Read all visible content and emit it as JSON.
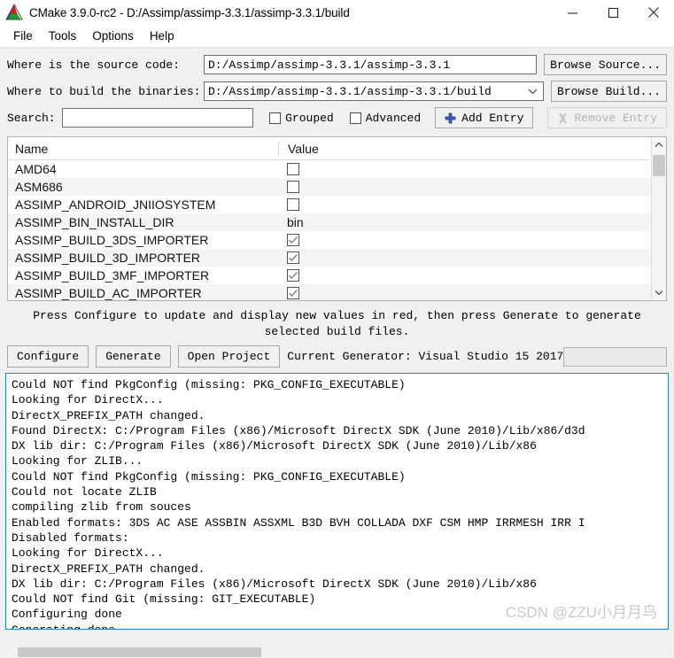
{
  "window": {
    "title": "CMake 3.9.0-rc2 - D:/Assimp/assimp-3.3.1/assimp-3.3.1/build",
    "app_icon": "cmake-logo-icon",
    "minimize_label": "minimize-icon",
    "maximize_label": "maximize-icon",
    "close_label": "close-icon"
  },
  "menubar": {
    "items": [
      {
        "label": "File"
      },
      {
        "label": "Tools"
      },
      {
        "label": "Options"
      },
      {
        "label": "Help"
      }
    ]
  },
  "form": {
    "source_label": "Where is the source code:",
    "source_value": "D:/Assimp/assimp-3.3.1/assimp-3.3.1",
    "browse_source_label": "Browse Source...",
    "build_label": "Where to build the binaries:",
    "build_value": "D:/Assimp/assimp-3.3.1/assimp-3.3.1/build",
    "browse_build_label": "Browse Build...",
    "search_label": "Search:",
    "search_value": "",
    "search_placeholder": "",
    "grouped_label": "Grouped",
    "grouped_checked": false,
    "advanced_label": "Advanced",
    "advanced_checked": false,
    "add_entry_label": "Add Entry",
    "add_entry_icon": "plus-icon",
    "remove_entry_label": "Remove Entry",
    "remove_entry_icon": "remove-x-icon",
    "remove_entry_disabled": true
  },
  "cache_table": {
    "columns": [
      "Name",
      "Value"
    ],
    "rows": [
      {
        "name": "AMD64",
        "type": "checkbox",
        "checked": false,
        "value": ""
      },
      {
        "name": "ASM686",
        "type": "checkbox",
        "checked": false,
        "value": ""
      },
      {
        "name": "ASSIMP_ANDROID_JNIIOSYSTEM",
        "type": "checkbox",
        "checked": false,
        "value": ""
      },
      {
        "name": "ASSIMP_BIN_INSTALL_DIR",
        "type": "text",
        "checked": false,
        "value": "bin"
      },
      {
        "name": "ASSIMP_BUILD_3DS_IMPORTER",
        "type": "checkbox",
        "checked": true,
        "value": ""
      },
      {
        "name": "ASSIMP_BUILD_3D_IMPORTER",
        "type": "checkbox",
        "checked": true,
        "value": ""
      },
      {
        "name": "ASSIMP_BUILD_3MF_IMPORTER",
        "type": "checkbox",
        "checked": true,
        "value": ""
      },
      {
        "name": "ASSIMP_BUILD_AC_IMPORTER",
        "type": "checkbox",
        "checked": true,
        "value": ""
      }
    ],
    "scrollbar": {
      "up_arrow": "chevron-up-icon",
      "down_arrow": "chevron-down-icon"
    }
  },
  "hint": {
    "line1": "Press Configure to update and display new values in red, then press Generate to generate",
    "line2": "selected build files."
  },
  "actions": {
    "configure_label": "Configure",
    "generate_label": "Generate",
    "open_project_label": "Open Project",
    "current_generator": "Current Generator: Visual Studio 15 2017",
    "progress_value": ""
  },
  "log": {
    "lines": [
      "Could NOT find PkgConfig (missing: PKG_CONFIG_EXECUTABLE)",
      "Looking for DirectX...",
      "DirectX_PREFIX_PATH changed.",
      "Found DirectX: C:/Program Files (x86)/Microsoft DirectX SDK (June 2010)/Lib/x86/d3d",
      "DX lib dir: C:/Program Files (x86)/Microsoft DirectX SDK (June 2010)/Lib/x86",
      "Looking for ZLIB...",
      "Could NOT find PkgConfig (missing: PKG_CONFIG_EXECUTABLE)",
      "Could not locate ZLIB",
      "compiling zlib from souces",
      "Enabled formats: 3DS AC ASE ASSBIN ASSXML B3D BVH COLLADA DXF CSM HMP IRRMESH IRR I",
      "Disabled formats:",
      "Looking for DirectX...",
      "DirectX_PREFIX_PATH changed.",
      "DX lib dir: C:/Program Files (x86)/Microsoft DirectX SDK (June 2010)/Lib/x86",
      "Could NOT find Git (missing: GIT_EXECUTABLE)",
      "Configuring done",
      "Generating done"
    ],
    "watermark": "CSDN @ZZU小月月鸟"
  },
  "colors": {
    "window_bg": "#f0f0f0",
    "log_border": "#2a7fd4",
    "accent_blue": "#2a4fb8",
    "row_alt": "#f4f4f4"
  }
}
